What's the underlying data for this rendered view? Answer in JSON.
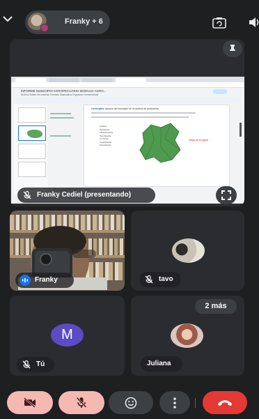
{
  "topbar": {
    "call_label": "Franky + 6"
  },
  "presentation": {
    "presenter_label": "Franky Cediel (presentando)",
    "shared_screen": {
      "doc_title": "INFORME MUNICIPIO AGROPECUARIO MODULO AGRO...",
      "menu": "Archivo  Editar  Ver  Insertar  Formato  Diapositiva  Organizar  Herramientas",
      "slide_heading_label": "Conceptos:",
      "slide_heading_text": "Apoyos del municipio en la cadena de producción",
      "list_items": [
        "Cultivos",
        "Ganadería",
        "Infraestructura",
        "Tecnificación",
        "Comercio",
        "Capacitación",
        "Financiación"
      ],
      "red_note": "mapa de la región",
      "speaker_notes": "Clic para agregar notas del orador"
    }
  },
  "participants": {
    "franky": {
      "name": "Franky"
    },
    "tavo": {
      "name": "tavo"
    },
    "tu": {
      "name": "Tú",
      "initial": "M"
    },
    "juliana": {
      "name": "Juliana",
      "more_label": "2 más"
    }
  },
  "colors": {
    "background": "#1e1f21",
    "tile": "#2b2c2f",
    "muted_control": "#f6b8b2",
    "hangup": "#e53935",
    "avatar_m": "#5b4bc4"
  },
  "icons": [
    "chevron-down-icon",
    "switch-camera-icon",
    "speaker-icon",
    "pin-icon",
    "mic-off-icon",
    "fullscreen-icon",
    "speaking-icon",
    "camera-off-icon",
    "emoji-icon",
    "more-vert-icon",
    "call-end-icon"
  ]
}
